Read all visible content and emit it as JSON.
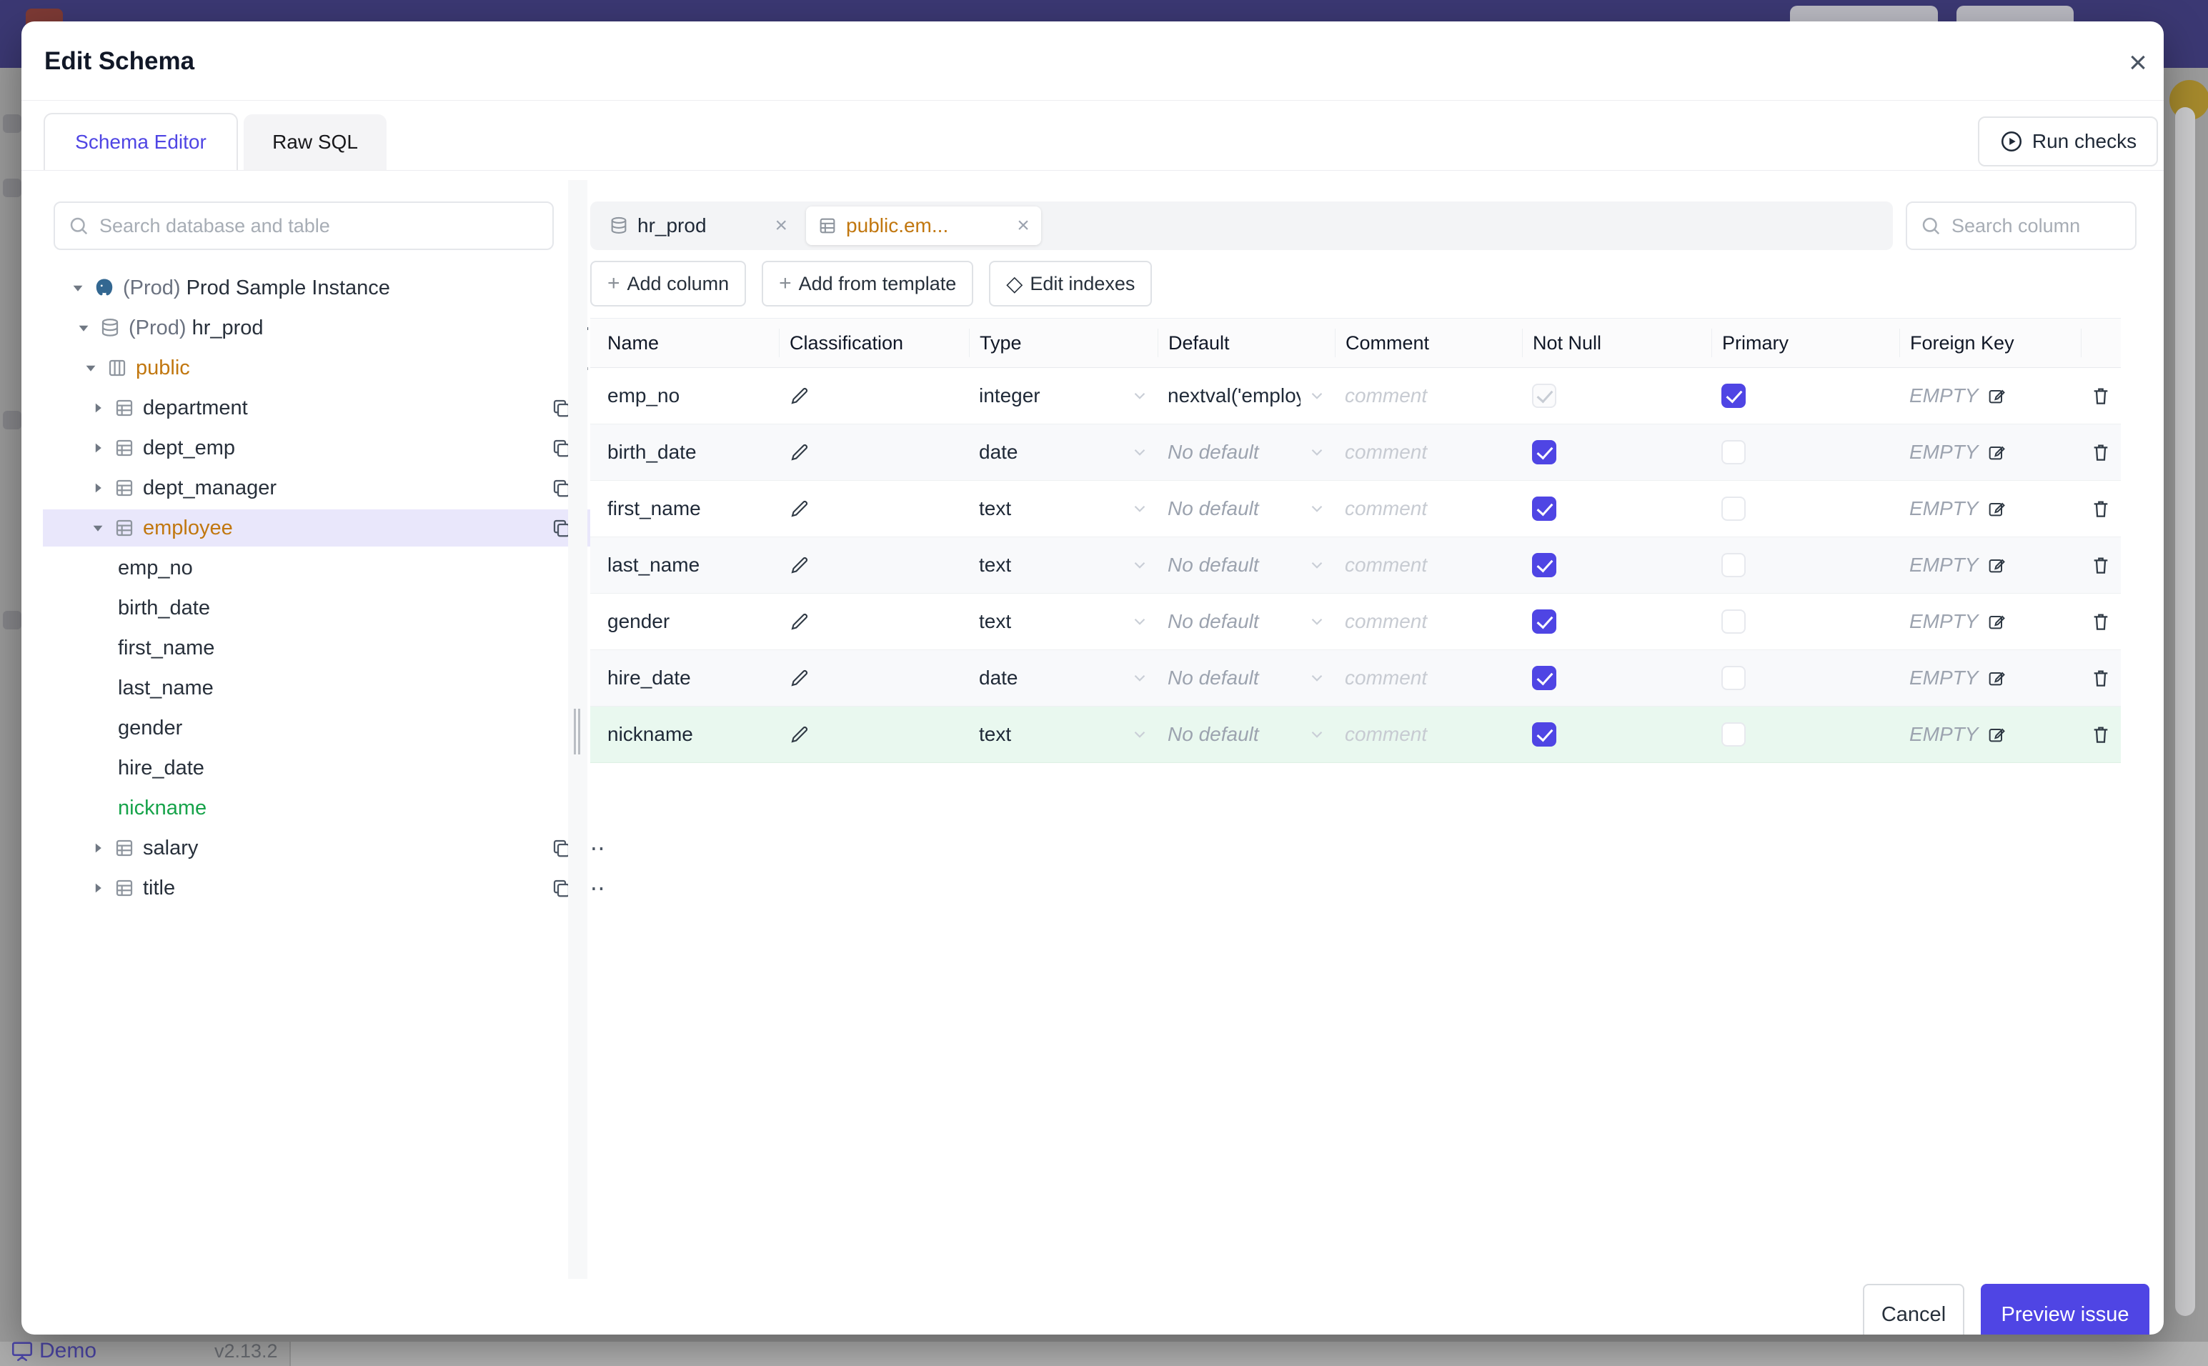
{
  "modal": {
    "title": "Edit Schema",
    "tab_schema_editor": "Schema Editor",
    "tab_raw_sql": "Raw SQL",
    "run_checks": "Run checks",
    "cancel": "Cancel",
    "preview_issue": "Preview issue"
  },
  "tree": {
    "search_placeholder": "Search database and table",
    "instance_env": "(Prod)",
    "instance_name": "Prod Sample Instance",
    "db_env": "(Prod)",
    "db_name": "hr_prod",
    "schema_name": "public",
    "tables": [
      "department",
      "dept_emp",
      "dept_manager"
    ],
    "selected_table": "employee",
    "columns": [
      "emp_no",
      "birth_date",
      "first_name",
      "last_name",
      "gender",
      "hire_date"
    ],
    "added_column": "nickname",
    "more_tables": [
      "salary",
      "title"
    ]
  },
  "editor": {
    "chips": [
      {
        "label": "hr_prod",
        "type": "database"
      },
      {
        "label": "public.em...",
        "type": "table"
      }
    ],
    "search_placeholder": "Search column",
    "actions": {
      "add_column": "Add column",
      "add_from_template": "Add from template",
      "edit_indexes": "Edit indexes"
    },
    "headers": {
      "name": "Name",
      "classification": "Classification",
      "type": "Type",
      "default": "Default",
      "comment": "Comment",
      "not_null": "Not Null",
      "primary": "Primary",
      "foreign_key": "Foreign Key"
    },
    "comment_placeholder": "comment",
    "fk_empty": "EMPTY",
    "rows": [
      {
        "name": "emp_no",
        "type": "integer",
        "default": "nextval('employ",
        "not_null": "dis",
        "primary": "on"
      },
      {
        "name": "birth_date",
        "type": "date",
        "default": "No default",
        "not_null": "on",
        "primary": "off"
      },
      {
        "name": "first_name",
        "type": "text",
        "default": "No default",
        "not_null": "on",
        "primary": "off"
      },
      {
        "name": "last_name",
        "type": "text",
        "default": "No default",
        "not_null": "on",
        "primary": "off"
      },
      {
        "name": "gender",
        "type": "text",
        "default": "No default",
        "not_null": "on",
        "primary": "off"
      },
      {
        "name": "hire_date",
        "type": "date",
        "default": "No default",
        "not_null": "on",
        "primary": "off"
      },
      {
        "name": "nickname",
        "type": "text",
        "default": "No default",
        "not_null": "on",
        "primary": "off"
      }
    ]
  },
  "background": {
    "demo": "Demo",
    "version": "v2.13.2"
  },
  "colors": {
    "accent_indigo": "#4f45e4",
    "modified_orange": "#c1770f",
    "added_green": "#16a34a",
    "topbar_navy": "#3b3873"
  }
}
